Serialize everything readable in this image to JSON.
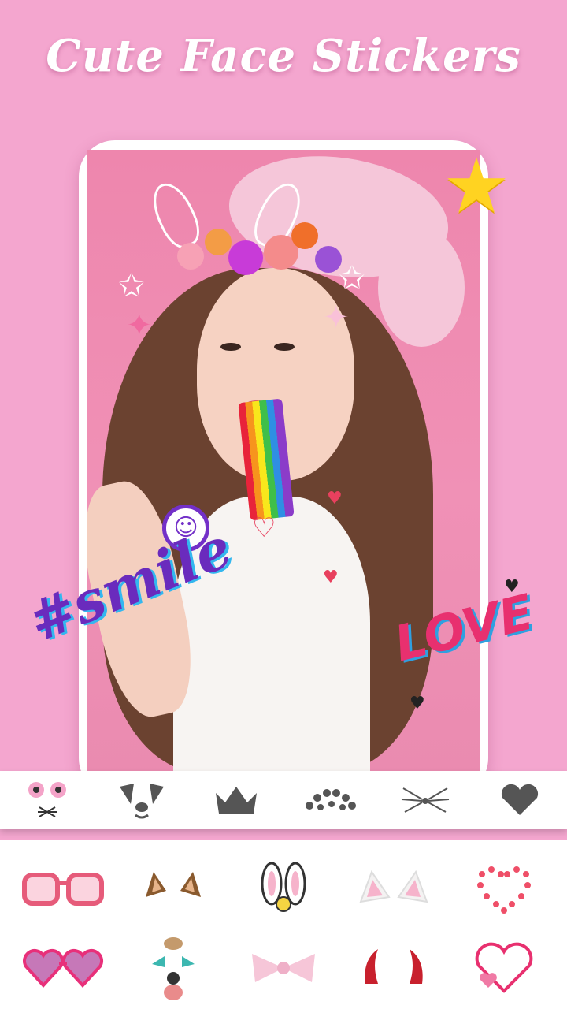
{
  "headline": "Cute Face Stickers",
  "photo_stickers": {
    "smile_text": "#smile",
    "love_text": "LOVE",
    "smiley": "☺"
  },
  "sticker_category_bar": {
    "items": [
      {
        "name": "pink-eyes-whiskers-icon"
      },
      {
        "name": "dog-ears-nose-icon"
      },
      {
        "name": "crown-icon"
      },
      {
        "name": "hearts-crown-icon"
      },
      {
        "name": "whiskers-icon"
      },
      {
        "name": "heart-icon"
      }
    ]
  },
  "sticker_grid": {
    "items": [
      {
        "name": "red-sunglasses-icon"
      },
      {
        "name": "dog-ears-icon"
      },
      {
        "name": "bunny-ears-headband-icon"
      },
      {
        "name": "cat-ears-icon"
      },
      {
        "name": "heart-dots-icon"
      },
      {
        "name": "heart-sunglasses-icon"
      },
      {
        "name": "puppy-face-icon"
      },
      {
        "name": "pink-bow-icon"
      },
      {
        "name": "devil-horns-icon"
      },
      {
        "name": "love-heart-icon"
      }
    ]
  },
  "colors": {
    "background": "#f4a6cf",
    "accent_purple": "#6a2bbd",
    "accent_pink": "#e8306f",
    "accent_blue": "#33b7ef",
    "bar_background": "#ffffff",
    "icon_gray": "#555555"
  }
}
